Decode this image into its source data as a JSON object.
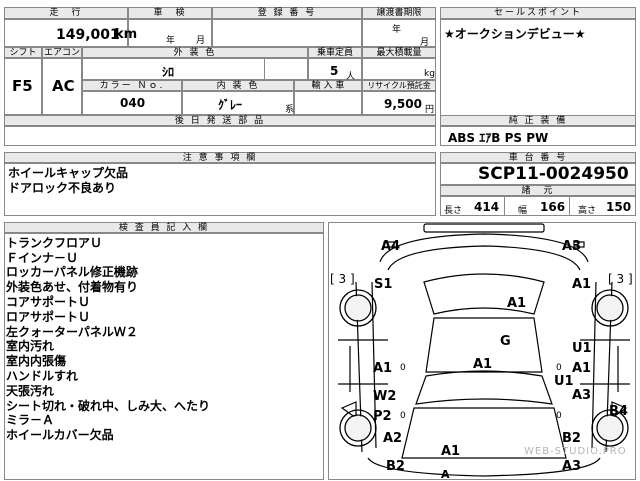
{
  "header": {
    "mileage_label": "走　行",
    "inspection_label": "車　検",
    "registration_label": "登 録 番 号",
    "transfer_deadline_label": "譲渡書期限",
    "sales_point_label": "セールスポイント",
    "mileage_value": "149,001",
    "mileage_unit": "km",
    "inspection_year_unit": "年",
    "inspection_month_unit": "月",
    "transfer_year_unit": "年",
    "transfer_month_unit": "月",
    "sales_point_text": "★オークションデビュー★"
  },
  "specs": {
    "shift_label": "シフト",
    "aircon_label": "エアコン",
    "exterior_color_label": "外 装 色",
    "capacity_label": "乗車定員",
    "max_load_label": "最大積載量",
    "shift_value": "F5",
    "aircon_value": "AC",
    "exterior_color_value": "ｼﾛ",
    "capacity_value": "5",
    "capacity_unit": "人",
    "max_load_unit": "kg",
    "color_no_label": "カラー Ｎｏ.",
    "interior_color_label": "内 装 色",
    "import_label": "輸 入 車",
    "recycle_label": "リサイクル預託金",
    "color_no_value": "040",
    "interior_color_value": "ｸﾞﾚｰ",
    "interior_color_suffix": "系",
    "recycle_value": "9,500",
    "recycle_unit": "円",
    "later_parts_label": "後 日 発 送 部 品",
    "genuine_equipment_label": "純 正 装 備",
    "genuine_equipment_value": "ABS ｴｱB PS PW"
  },
  "notes": {
    "caution_label": "注 意 事 項 欄",
    "caution_lines": [
      "ホイールキャップ欠品",
      "ドアロック不良あり"
    ],
    "chassis_label": "車 台 番 号",
    "chassis_value": "SCP11-0024950",
    "dimensions_label": "諸　元",
    "length_label": "長さ",
    "length_value": "414",
    "width_label": "幅",
    "width_value": "166",
    "height_label": "高さ",
    "height_value": "150"
  },
  "inspector": {
    "label": "検 査 員 記 入 欄",
    "lines": [
      "トランクフロアＵ",
      "Ｆインナ－Ｕ",
      "ロッカーパネル修正機跡",
      "外装色あせ、付着物有り",
      "コアサポートＵ",
      "ロアサポートＵ",
      "左クォーターパネルＷ２",
      "室内汚れ",
      "室内内張傷",
      "ハンドルすれ",
      "天張汚れ",
      "シート切れ・破れ中、しみ大、へたり",
      "ミラ－Ａ",
      "ホイールカバー欠品"
    ]
  },
  "diagram": {
    "codes": {
      "a4": "A4",
      "a3_top": "A3",
      "s1": "S1",
      "a1_fr": "A1",
      "a1_roof": "A1",
      "g": "G",
      "a1_hood": "A1",
      "a1_left": "A1",
      "w2": "W2",
      "p2": "P2",
      "u1_right": "U1",
      "a1_right": "A1",
      "u1_center": "U1",
      "a3_right": "A3",
      "b4": "B4",
      "a2": "A2",
      "a1_bottom": "A1",
      "b2_left": "B2",
      "b2_right": "B2",
      "a3_bottom": "A3",
      "a_partial": "A",
      "br_left_num": "3",
      "br_right_num": "3"
    },
    "zero_marks": [
      "0",
      "0",
      "0",
      "0"
    ]
  },
  "watermark": "WEB-STUDIO.PRO"
}
